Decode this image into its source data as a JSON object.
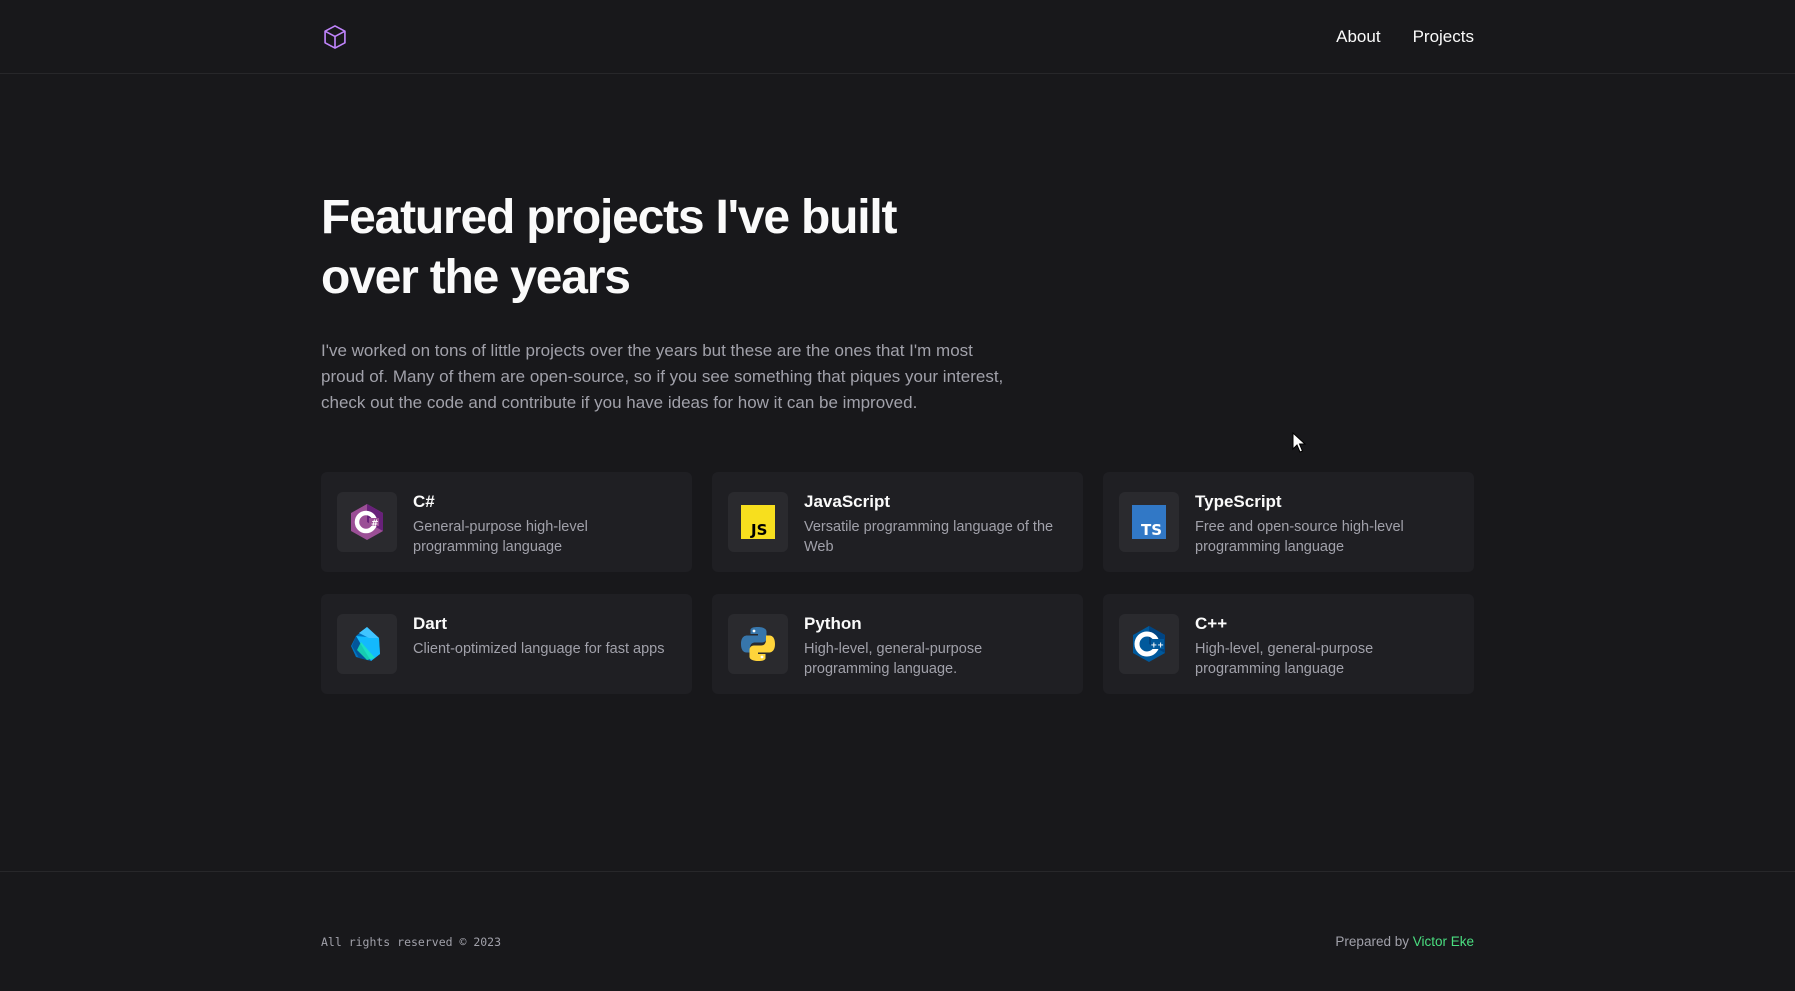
{
  "header": {
    "logo_icon": "cube-icon",
    "nav": [
      {
        "label": "About"
      },
      {
        "label": "Projects"
      }
    ]
  },
  "hero": {
    "title": "Featured projects I've built over the years",
    "intro": "I've worked on tons of little projects over the years but these are the ones that I'm most proud of. Many of them are open-source, so if you see something that piques your interest, check out the code and contribute if you have ideas for how it can be improved."
  },
  "projects": [
    {
      "name": "C#",
      "description": "General-purpose high-level programming language",
      "icon": "csharp-icon"
    },
    {
      "name": "JavaScript",
      "description": "Versatile programming language of the Web",
      "icon": "javascript-icon"
    },
    {
      "name": "TypeScript",
      "description": "Free and open-source high-level programming language",
      "icon": "typescript-icon"
    },
    {
      "name": "Dart",
      "description": "Client-optimized language for fast apps",
      "icon": "dart-icon"
    },
    {
      "name": "Python",
      "description": "High-level, general-purpose programming language.",
      "icon": "python-icon"
    },
    {
      "name": "C++",
      "description": "High-level, general-purpose programming language",
      "icon": "cplusplus-icon"
    }
  ],
  "footer": {
    "copyright": "All rights reserved © 2023",
    "prepared_prefix": "Prepared by ",
    "author": "Victor Eke"
  },
  "colors": {
    "background": "#18181b",
    "card": "#1f1f23",
    "accent_green": "#4ade80",
    "logo_purple": "#c084fc"
  }
}
